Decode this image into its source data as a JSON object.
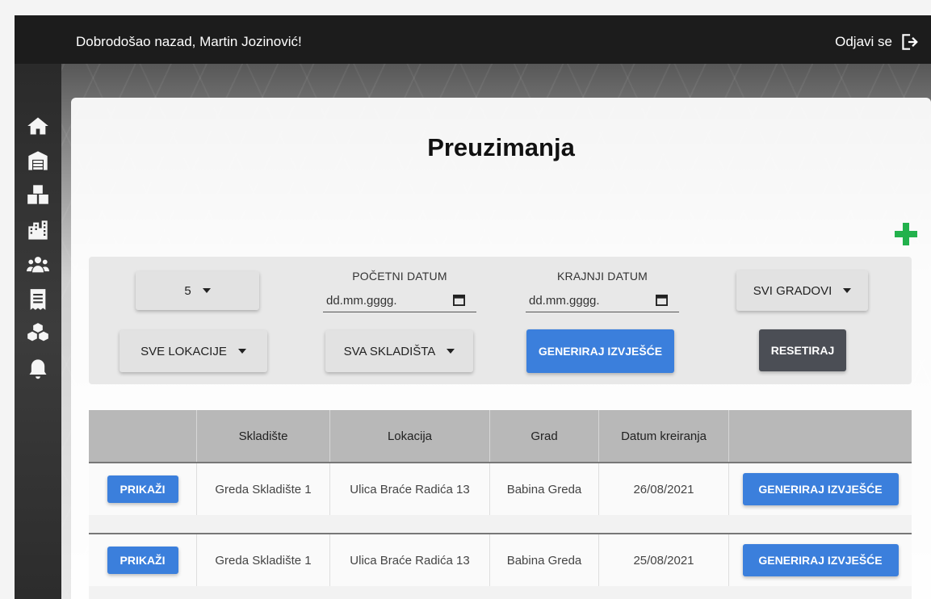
{
  "header": {
    "welcome": "Dobrodošao nazad, Martin Jozinović!",
    "logout_label": "Odjavi se"
  },
  "sidebar": {
    "items": [
      "home-icon",
      "warehouse-icon",
      "boxes-icon",
      "city-icon",
      "users-icon",
      "receipt-icon",
      "cubes-icon",
      "bell-icon"
    ]
  },
  "page": {
    "title": "Preuzimanja"
  },
  "filters": {
    "per_page": "5",
    "start_date_label": "POČETNI DATUM",
    "start_date_placeholder": "dd.mm.gggg.",
    "end_date_label": "KRAJNJI DATUM",
    "end_date_placeholder": "dd.mm.gggg.",
    "city_select": "SVI GRADOVI",
    "location_select": "SVE LOKACIJE",
    "warehouse_select": "SVA SKLADIŠTA",
    "generate_label": "GENERIRAJ IZVJEŠĆE",
    "reset_label": "RESETIRAJ"
  },
  "table": {
    "headers": [
      "",
      "Skladište",
      "Lokacija",
      "Grad",
      "Datum kreiranja",
      ""
    ],
    "rows": [
      {
        "action": "PRIKAŽI",
        "warehouse": "Greda Skladište 1",
        "location": "Ulica Braće Radića 13",
        "city": "Babina Greda",
        "date": "26/08/2021",
        "report": "GENERIRAJ IZVJEŠĆE"
      },
      {
        "action": "PRIKAŽI",
        "warehouse": "Greda Skladište 1",
        "location": "Ulica Braće Radića 13",
        "city": "Babina Greda",
        "date": "25/08/2021",
        "report": "GENERIRAJ IZVJEŠĆE"
      }
    ]
  },
  "colors": {
    "primary": "#3b7fdc",
    "dark_button": "#4b4e55",
    "add_green": "#22b14c",
    "topbar": "#1c1c1c"
  }
}
